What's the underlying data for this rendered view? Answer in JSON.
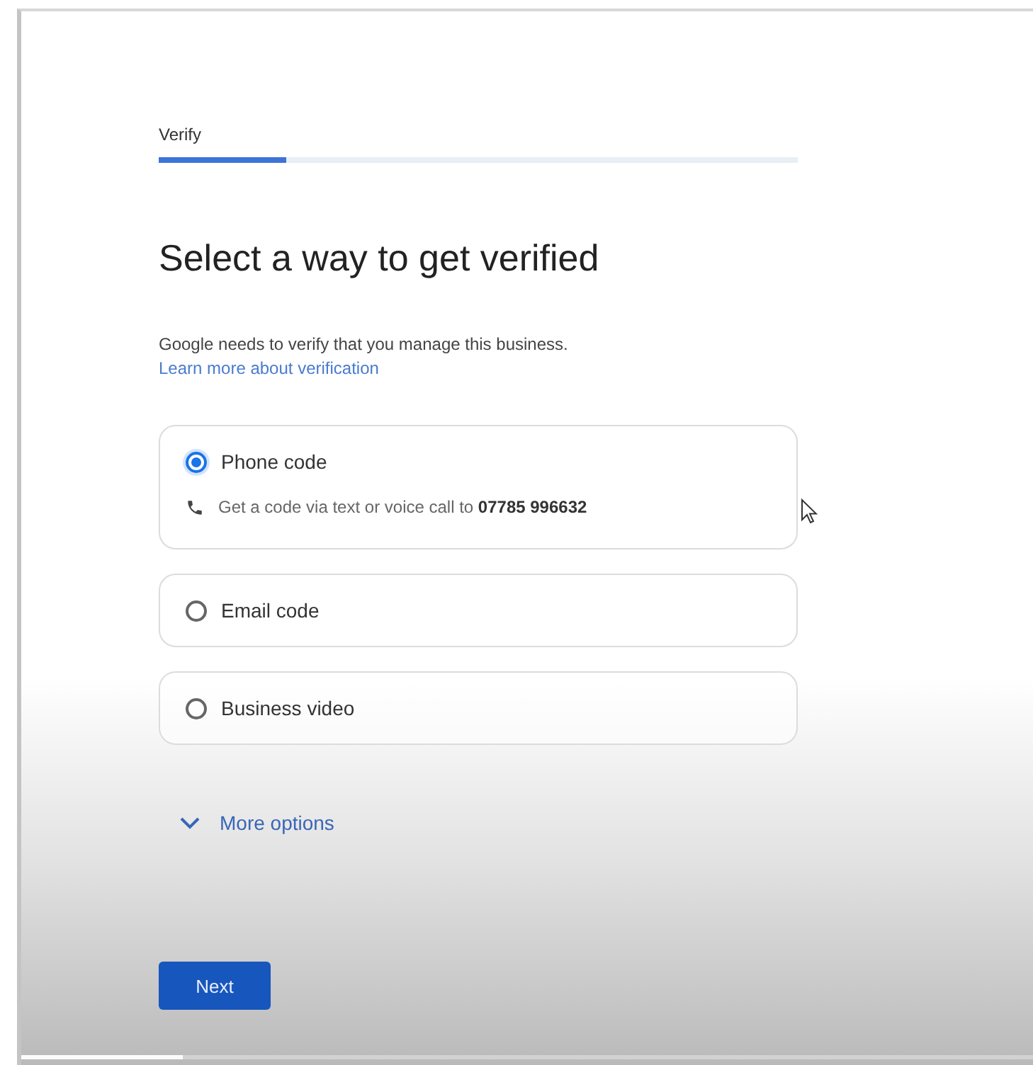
{
  "stepper": {
    "label": "Verify",
    "level": 0.2
  },
  "title": "Select a way to get verified",
  "description": "Google needs to verify that you manage this business.",
  "learn_more_link": "Learn more about verification",
  "options": [
    {
      "label": "Phone code",
      "selected": true,
      "detail": "Get a code via text or voice call to **07785 996632**"
    },
    {
      "label": "Email code",
      "selected": false
    },
    {
      "label": "Business video",
      "selected": false
    }
  ],
  "more_options": {
    "label": "More options",
    "expanded": false
  },
  "next_button": "Next",
  "video_progress": {
    "level": 0.16
  }
}
